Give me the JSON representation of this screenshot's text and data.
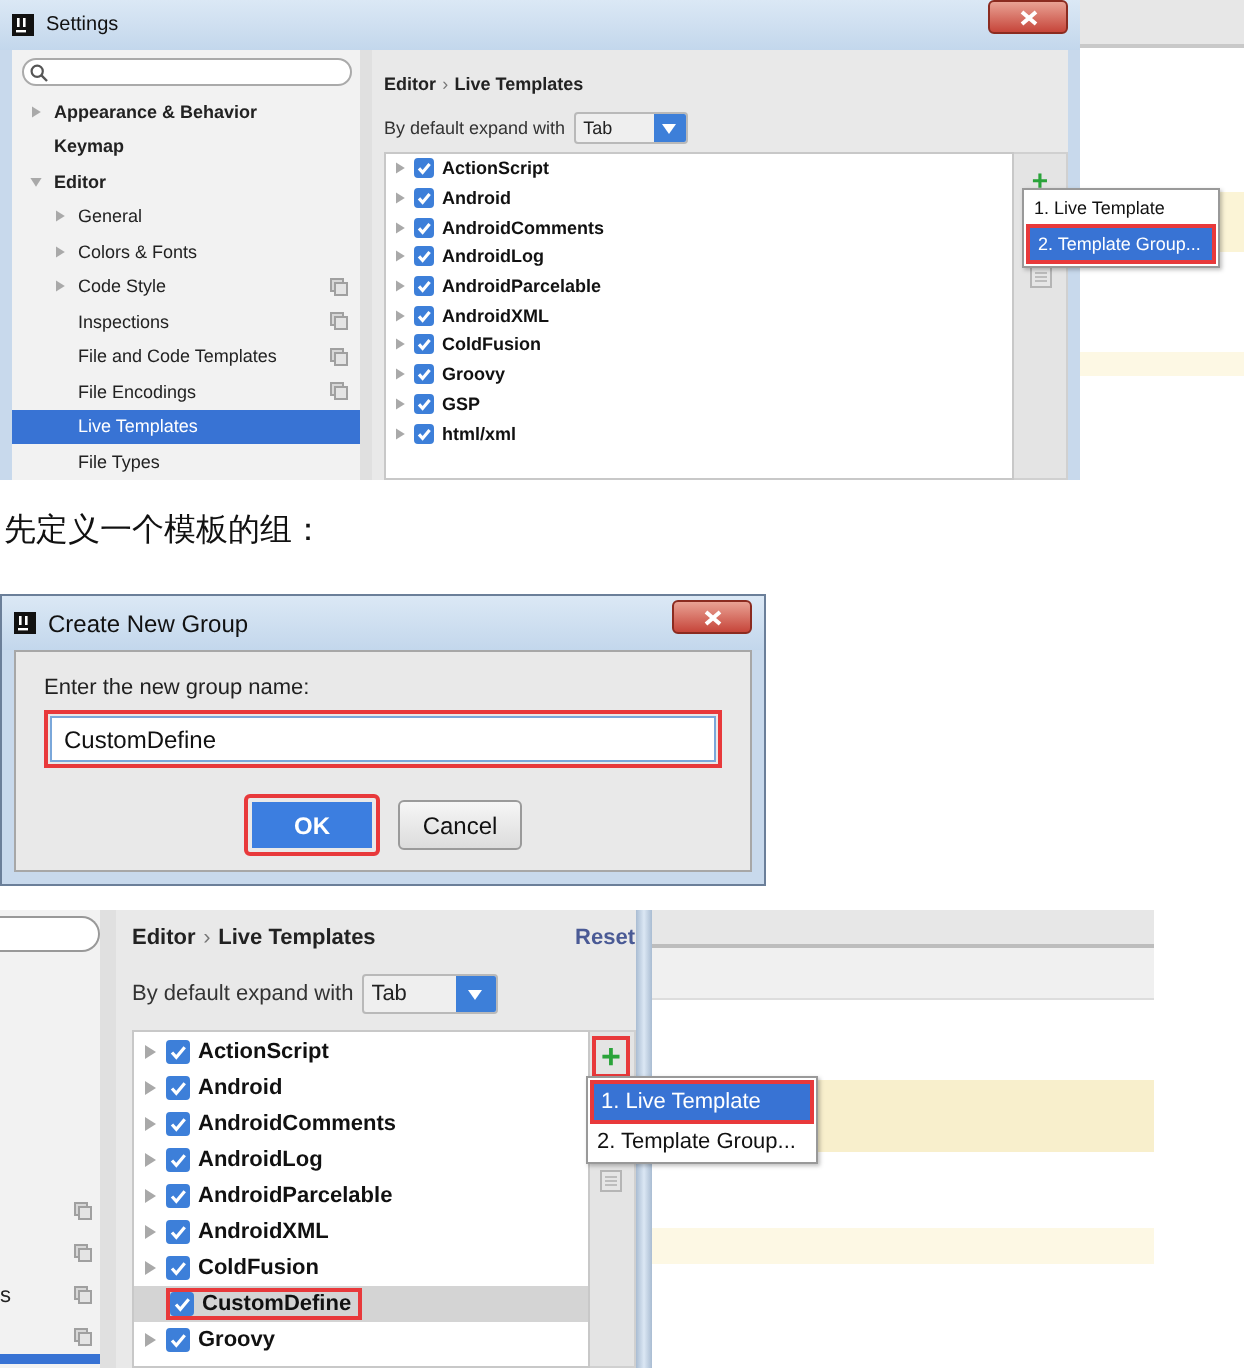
{
  "settings_window": {
    "title": "Settings",
    "sidebar": [
      {
        "label": "Appearance & Behavior",
        "expandable": true,
        "expanded": false,
        "bold": true,
        "project_icon": false,
        "selected": false
      },
      {
        "label": "Keymap",
        "expandable": false,
        "bold": true,
        "project_icon": false,
        "selected": false
      },
      {
        "label": "Editor",
        "expandable": true,
        "expanded": true,
        "bold": true,
        "project_icon": false,
        "selected": false,
        "children": [
          {
            "label": "General",
            "expandable": true,
            "expanded": false,
            "bold": false,
            "project_icon": false,
            "selected": false
          },
          {
            "label": "Colors & Fonts",
            "expandable": true,
            "expanded": false,
            "bold": false,
            "project_icon": false,
            "selected": false
          },
          {
            "label": "Code Style",
            "expandable": true,
            "expanded": false,
            "bold": false,
            "project_icon": true,
            "selected": false
          },
          {
            "label": "Inspections",
            "expandable": false,
            "bold": false,
            "project_icon": true,
            "selected": false
          },
          {
            "label": "File and Code Templates",
            "expandable": false,
            "bold": false,
            "project_icon": true,
            "selected": false
          },
          {
            "label": "File Encodings",
            "expandable": false,
            "bold": false,
            "project_icon": true,
            "selected": false
          },
          {
            "label": "Live Templates",
            "expandable": false,
            "bold": false,
            "project_icon": false,
            "selected": true
          },
          {
            "label": "File Types",
            "expandable": false,
            "bold": false,
            "project_icon": false,
            "selected": false
          }
        ]
      }
    ],
    "breadcrumb": {
      "parent": "Editor",
      "separator": "›",
      "current": "Live Templates"
    },
    "expand_label": "By default expand with",
    "expand_value": "Tab",
    "template_groups": [
      {
        "label": "ActionScript",
        "expandable": true,
        "checked": true,
        "selected": false,
        "highlighted": false
      },
      {
        "label": "Android",
        "expandable": true,
        "checked": true,
        "selected": false,
        "highlighted": false
      },
      {
        "label": "AndroidComments",
        "expandable": true,
        "checked": true,
        "selected": false,
        "highlighted": false
      },
      {
        "label": "AndroidLog",
        "expandable": true,
        "checked": true,
        "selected": false,
        "highlighted": false
      },
      {
        "label": "AndroidParcelable",
        "expandable": true,
        "checked": true,
        "selected": false,
        "highlighted": false
      },
      {
        "label": "AndroidXML",
        "expandable": true,
        "checked": true,
        "selected": false,
        "highlighted": false
      },
      {
        "label": "ColdFusion",
        "expandable": true,
        "checked": true,
        "selected": false,
        "highlighted": false
      },
      {
        "label": "Groovy",
        "expandable": true,
        "checked": true,
        "selected": false,
        "highlighted": false
      },
      {
        "label": "GSP",
        "expandable": true,
        "checked": true,
        "selected": false,
        "highlighted": false
      },
      {
        "label": "html/xml",
        "expandable": true,
        "checked": true,
        "selected": false,
        "highlighted": false
      }
    ],
    "add_button": {
      "label": "+",
      "highlighted": false
    },
    "add_menu": [
      {
        "label": "1. Live Template",
        "selected": false,
        "highlighted": false
      },
      {
        "label": "2. Template Group...",
        "selected": true,
        "highlighted": true
      }
    ]
  },
  "caption": "先定义一个模板的组：",
  "create_group_dialog": {
    "title": "Create New Group",
    "prompt": "Enter the new group name:",
    "input": {
      "value": "CustomDefine",
      "highlighted": true
    },
    "buttons": [
      {
        "label": "OK",
        "kind": "default",
        "highlighted": true
      },
      {
        "label": "Cancel",
        "kind": "normal",
        "highlighted": false
      }
    ]
  },
  "live_templates_panel": {
    "sidebar": [
      {
        "project_icon": true,
        "selected": false
      },
      {
        "project_icon": true,
        "selected": false
      },
      {
        "label": "s",
        "project_icon": true,
        "selected": false
      },
      {
        "project_icon": true,
        "selected": false
      },
      {
        "project_icon": false,
        "selected": true
      }
    ],
    "breadcrumb": {
      "parent": "Editor",
      "separator": "›",
      "current": "Live Templates"
    },
    "reset_link": "Reset",
    "expand_label": "By default expand with",
    "expand_value": "Tab",
    "template_groups": [
      {
        "label": "ActionScript",
        "expandable": true,
        "checked": true,
        "selected": false,
        "highlighted": false
      },
      {
        "label": "Android",
        "expandable": true,
        "checked": true,
        "selected": false,
        "highlighted": false
      },
      {
        "label": "AndroidComments",
        "expandable": true,
        "checked": true,
        "selected": false,
        "highlighted": false
      },
      {
        "label": "AndroidLog",
        "expandable": true,
        "checked": true,
        "selected": false,
        "highlighted": false
      },
      {
        "label": "AndroidParcelable",
        "expandable": true,
        "checked": true,
        "selected": false,
        "highlighted": false
      },
      {
        "label": "AndroidXML",
        "expandable": true,
        "checked": true,
        "selected": false,
        "highlighted": false
      },
      {
        "label": "ColdFusion",
        "expandable": true,
        "checked": true,
        "selected": false,
        "highlighted": false
      },
      {
        "label": "CustomDefine",
        "expandable": false,
        "checked": true,
        "selected": true,
        "highlighted": true
      },
      {
        "label": "Groovy",
        "expandable": true,
        "checked": true,
        "selected": false,
        "highlighted": false
      }
    ],
    "add_button": {
      "label": "+",
      "highlighted": true
    },
    "add_menu": [
      {
        "label": "1. Live Template",
        "selected": true,
        "highlighted": true
      },
      {
        "label": "2. Template Group...",
        "selected": false,
        "highlighted": false
      }
    ]
  }
}
